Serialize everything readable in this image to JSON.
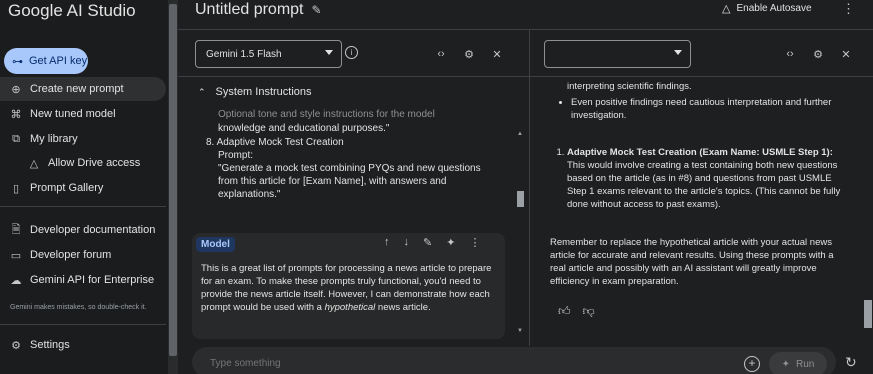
{
  "sidebar": {
    "brand": "Google AI Studio",
    "api_key_label": "Get API key",
    "items": [
      {
        "label": "Create new prompt",
        "icon": "plus-circle-icon"
      },
      {
        "label": "New tuned model",
        "icon": "tune-icon"
      },
      {
        "label": "My library",
        "icon": "library-icon"
      },
      {
        "label": "Allow Drive access",
        "icon": "drive-icon"
      },
      {
        "label": "Prompt Gallery",
        "icon": "book-icon"
      },
      {
        "label": "Developer documentation",
        "icon": "document-icon"
      },
      {
        "label": "Developer forum",
        "icon": "forum-icon"
      },
      {
        "label": "Gemini API for Enterprise",
        "icon": "cloud-icon"
      },
      {
        "label": "Settings",
        "icon": "gear-icon"
      }
    ],
    "disclaimer": "Gemini makes mistakes, so double-check it."
  },
  "topbar": {
    "title": "Untitled prompt",
    "autosave_label": "Enable Autosave"
  },
  "left_panel": {
    "model_select": "Gemini 1.5 Flash",
    "system_instructions_title": "System Instructions",
    "system_instructions_placeholder": "Optional tone and style instructions for the model",
    "user_text": [
      "knowledge and educational purposes.\"",
      "8. Adaptive Mock Test Creation",
      "Prompt:",
      "\"Generate a mock test combining PYQs and new questions",
      "from this article for [Exam Name], with answers and",
      "explanations.\""
    ],
    "model_badge": "Model",
    "model_text_1": "This is a great list of prompts for processing a news article to prepare for an exam. To make these prompts truly functional, you'd need to provide the news article itself. However, I can demonstrate how each prompt would be used with a ",
    "model_text_italic": "hypothetical",
    "model_text_2": " news article."
  },
  "right_panel": {
    "model_select": "",
    "bullet_1": "interpreting scientific findings.",
    "bullet_2": "Even positive findings need cautious interpretation and further investigation.",
    "numbered_title": "Adaptive Mock Test Creation (Exam Name: USMLE Step 1):",
    "numbered_body": " This would involve creating a test containing both new questions based on the article (as in #8) and questions from past USMLE Step 1 exams relevant to the article's topics. (This cannot be fully done without access to past exams).",
    "closing": "Remember to replace the hypothetical article with your actual news article for accurate and relevant results. Using these prompts with a real article and possibly with an AI assistant will greatly improve efficiency in exam preparation."
  },
  "prompt_bar": {
    "placeholder": "Type something",
    "run_label": "Run"
  }
}
